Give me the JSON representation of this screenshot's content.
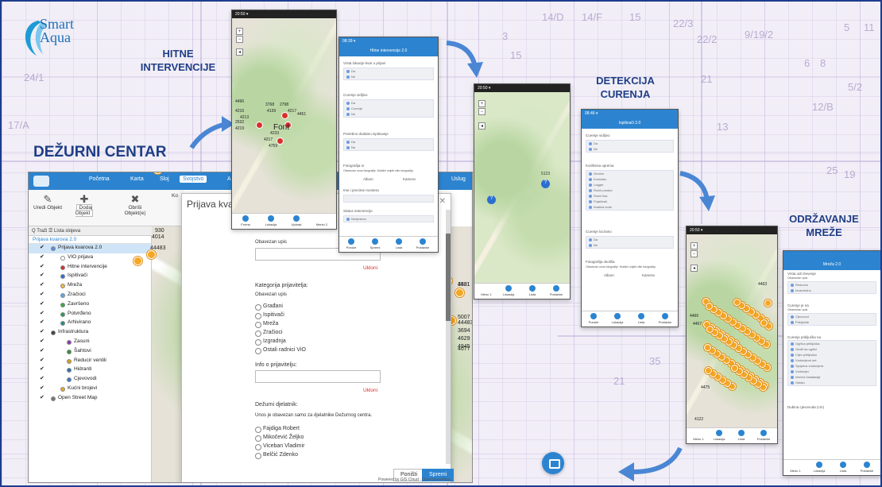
{
  "logo": {
    "line1": "Smart",
    "line2": "Aqua"
  },
  "titles": {
    "hitne": "HITNE INTERVENCIJE",
    "dezurni": "DEŽURNI CENTAR",
    "detekcija": "DETEKCIJA CURENJA",
    "odrzavanje": "ODRŽAVANJE MREŽE"
  },
  "background_numbers": [
    "24/1",
    "14/D",
    "14/F",
    "15",
    "22/3",
    "22/2",
    "9/19/2",
    "5",
    "11",
    "17/A",
    "21",
    "12/B",
    "6",
    "8",
    "25",
    "19",
    "35",
    "21",
    "3",
    "15",
    "5/2",
    "13"
  ],
  "desktop": {
    "nav": [
      "Početna",
      "Karta",
      "Sloj",
      "Svojstvo",
      "Analize"
    ],
    "active_nav": "Svojstvo",
    "nav_right": "Uslug",
    "toolbar": [
      {
        "icon": "edit-icon",
        "label": "Uredi Objekt"
      },
      {
        "icon": "plus-icon",
        "label": "Dodaj Objekt"
      },
      {
        "icon": "close-icon",
        "label": "Obriši Objekt(e)"
      },
      {
        "icon": "",
        "label": "Ko"
      }
    ],
    "toolbar_dropdown": "Dodaj Objekt",
    "panelbar": "Q  Traži  ☰ Lista slojeva",
    "tree_head": "Prijava kvarova 2.0",
    "tree": [
      {
        "label": "Prijava kvarova 2.0",
        "color": "#5b8fd6",
        "indent": 28,
        "selected": true
      },
      {
        "label": "VIO prijava",
        "color": "#ffffff",
        "indent": 40
      },
      {
        "label": "Hitne intervencije",
        "color": "#d9302c",
        "indent": 40
      },
      {
        "label": "Ispitivači",
        "color": "#2c6fd0",
        "indent": 40
      },
      {
        "label": "Mreža",
        "color": "#f0b640",
        "indent": 40
      },
      {
        "label": "Zračioci",
        "color": "#5aa7e8",
        "indent": 40
      },
      {
        "label": "Završeno",
        "color": "#3aa845",
        "indent": 40
      },
      {
        "label": "Potvrđeno",
        "color": "#2f9a5a",
        "indent": 40
      },
      {
        "label": "Arhivirano",
        "color": "#2a8a8a",
        "indent": 40
      },
      {
        "label": "Infrastruktura",
        "color": "#444444",
        "indent": 28
      },
      {
        "label": "Zasuni",
        "color": "#8a3ab8",
        "indent": 48
      },
      {
        "label": "Šahtovi",
        "color": "#3a8a3a",
        "indent": 48
      },
      {
        "label": "Reducir ventili",
        "color": "#d4a020",
        "indent": 48
      },
      {
        "label": "Hidranti",
        "color": "#2a70b8",
        "indent": 48
      },
      {
        "label": "Cjevovodi",
        "color": "#3a7ac8",
        "indent": 48
      },
      {
        "label": "Kućni brojevi",
        "color": "#e8a82a",
        "indent": 40
      },
      {
        "label": "Open Street Map",
        "color": "#777777",
        "indent": 28
      }
    ],
    "map_labels": [
      "3948",
      "4866",
      "4724",
      "3975",
      "930",
      "4014",
      "44483",
      "4025",
      "3531",
      "4481",
      "5007",
      "44483",
      "3694",
      "4629",
      "4945",
      "4077",
      "376"
    ],
    "footer_credit": "Powered by GIS Cloud  ·  OpenStreetMap",
    "dialog": {
      "title": "Prijava kva",
      "required1": "Obavezan upis",
      "remove1": "Ukloni",
      "kategorija_label": "Kategorija prijavitelja:",
      "required2": "Obavezan upis",
      "kategorije": [
        "Građani",
        "Ispitivači",
        "Mreža",
        "Zračioci",
        "Izgradnja",
        "Ostali radnici ViO"
      ],
      "info_label": "Info o prijavitelju:",
      "remove2": "Ukloni",
      "dezurni_label": "Dežurni djelatnik:",
      "dezurni_note": "Unos je obavezan samo za djelatnike Dežurnog centra.",
      "djelatnici": [
        "Fajdiga Robert",
        "Mikočević Željko",
        "Viceban Vladimir",
        "Belčić Zdenko"
      ],
      "cancel": "Poništi",
      "save": "Spremi"
    }
  },
  "phone1": {
    "time": "20:50 ▾",
    "map_labels": [
      "4496",
      "3768",
      "2798",
      "4216",
      "4139",
      "4213",
      "2532",
      "4217",
      "4451",
      "4233",
      "4219",
      "4217",
      "4759"
    ],
    "font_label": "Font",
    "bottom": [
      "Forma",
      "Lokacija",
      "Upload",
      "Meniu 2"
    ]
  },
  "phone2": {
    "time": "08:39 ▾",
    "header": "Hitne intervencije 2.0",
    "sections": [
      {
        "label": "Vrsta lokacije kvar u prijavi",
        "opts": [
          "Da",
          "Ne"
        ]
      },
      {
        "label": "Curenje vidljivo",
        "opts": [
          "Da",
          "Curenje",
          "Ne"
        ]
      },
      {
        "label": "Potrebno dodatno ispitivanje",
        "opts": [
          "Da",
          "Ne"
        ]
      }
    ],
    "foto_label": "Fotografija m",
    "foto_note": "Obavezan unos fotografije. Mobilni unijeti više fotografija.",
    "album": "Album",
    "kamera": "Kamera",
    "ime_label": "Ime i prezime montera",
    "status_label": "Status intervencije",
    "status_value": "Neriješeno",
    "bottom": [
      "Poruke",
      "Spremi",
      "Lista",
      "Postavke"
    ]
  },
  "phone3": {
    "time": "20:50 ▾",
    "labels": [
      "5123"
    ],
    "bottom": [
      "Menu 1",
      "Lokacija",
      "Lista",
      "Postavke"
    ]
  },
  "phone4": {
    "time": "08:46 ▾",
    "header": "Ispitivači 2.0",
    "sections": [
      {
        "label": "Curenje vidljivo",
        "opts": [
          "Da",
          "Ne"
        ]
      },
      {
        "label": "Korištena oprema",
        "opts": [
          "Geofon",
          "Korelator",
          "Logger",
          "Ručni prostor",
          "Ručni tlac",
          "Pojačivač",
          "Analiza vode"
        ]
      },
      {
        "label": "Curenje locirano",
        "opts": [
          "Da",
          "Ne"
        ]
      }
    ],
    "foto_label": "Fotografija okoliša",
    "foto_note": "Obavezan unos fotografije. Mobilni unijeti više fotografija.",
    "album": "Album",
    "kamera": "Kamera",
    "bottom": [
      "Poruke",
      "Lokacija",
      "Lista",
      "Postavke"
    ]
  },
  "phone5": {
    "time": "20:50 ▾",
    "labels": [
      "4463",
      "4467",
      "4122",
      "4475",
      "4466"
    ],
    "bottom": [
      "Menu 1",
      "Lokacija",
      "Lista",
      "Postavke"
    ]
  },
  "phone6": {
    "header": "Mreža 2.0",
    "sections": [
      {
        "label": "Vrsta odr Devenje",
        "note": "Obavezan upis",
        "opts": [
          "Redovno",
          "Izvanredno"
        ]
      },
      {
        "label": "Curenje je na",
        "note": "Obavezan upis",
        "opts": [
          "Cjevovod",
          "Priključak"
        ]
      },
      {
        "label": "Curenje priključka na",
        "opts": [
          "Ogrlica priključka",
          "Ventil na ogrlici",
          "Cijev priključka",
          "Vodomjerni set",
          "Spojnica vodomjera",
          "Vodomjer",
          "Interna instalacija",
          "Ostalo"
        ]
      }
    ],
    "dubina": "Dubina cjevovoda (cm)",
    "bottom": [
      "Menu 1",
      "Lokacija",
      "Lista",
      "Postavke"
    ]
  },
  "colors": {
    "title": "#1f3e86",
    "accent": "#2c84d0",
    "pin": "#f5a623",
    "danger": "#d9302c"
  }
}
